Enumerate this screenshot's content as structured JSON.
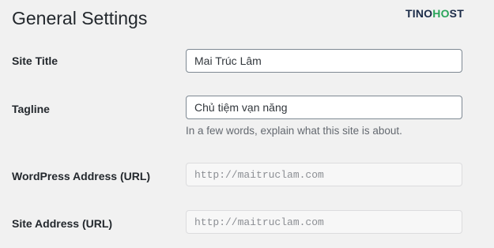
{
  "page": {
    "title": "General Settings"
  },
  "brand": {
    "prefix": "TINO",
    "accent_letter": "H",
    "accent_glyph": "O",
    "suffix": "ST"
  },
  "settings": {
    "site_title": {
      "label": "Site Title",
      "value": "Mai Trúc Lâm"
    },
    "tagline": {
      "label": "Tagline",
      "value": "Chủ tiệm vạn năng",
      "description": "In a few words, explain what this site is about."
    },
    "wordpress_address": {
      "label": "WordPress Address (URL)",
      "value": "http://maitruclam.com"
    },
    "site_address": {
      "label": "Site Address (URL)",
      "value": "http://maitruclam.com"
    }
  },
  "colors": {
    "background": "#f1f1f1",
    "brand_dark": "#1b2b48",
    "brand_accent": "#2aa55a"
  }
}
